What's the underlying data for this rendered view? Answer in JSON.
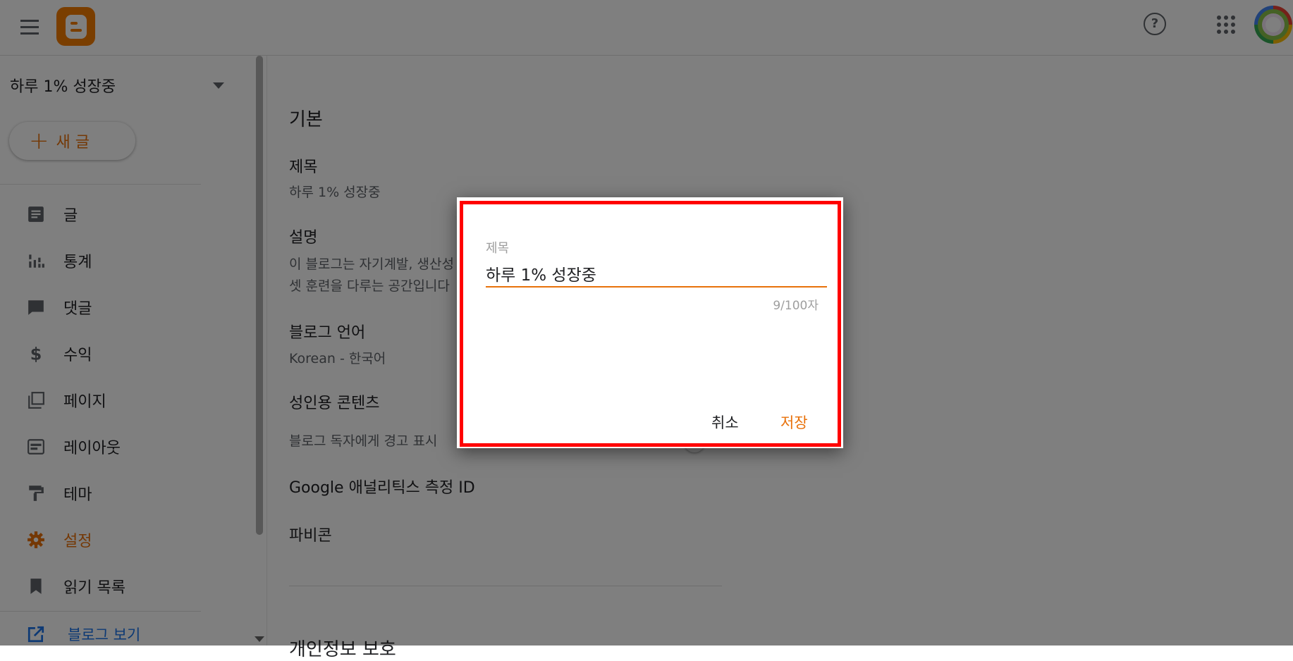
{
  "header": {
    "help_icon": "help-circle-icon",
    "apps_icon": "apps-grid-icon"
  },
  "sidebar": {
    "blog_title": "하루 1% 성장중",
    "new_post_label": "새 글",
    "items": [
      {
        "label": "글",
        "icon": "posts-icon"
      },
      {
        "label": "통계",
        "icon": "stats-icon"
      },
      {
        "label": "댓글",
        "icon": "comments-icon"
      },
      {
        "label": "수익",
        "icon": "dollar-icon"
      },
      {
        "label": "페이지",
        "icon": "pages-icon"
      },
      {
        "label": "레이아웃",
        "icon": "layout-icon"
      },
      {
        "label": "테마",
        "icon": "theme-icon"
      },
      {
        "label": "설정",
        "icon": "gear-icon",
        "active": true
      },
      {
        "label": "읽기 목록",
        "icon": "bookmark-icon"
      }
    ],
    "view_blog_label": "블로그 보기"
  },
  "main": {
    "section_title": "기본",
    "settings": [
      {
        "label": "제목",
        "value": "하루 1% 성장중"
      },
      {
        "label": "설명",
        "value_line1": "이 블로그는 자기계발, 생산성",
        "value_line2": "셋 훈련을 다루는 공간입니다"
      },
      {
        "label": "블로그 언어",
        "value": "Korean - 한국어"
      },
      {
        "label": "성인용 콘텐츠",
        "value": "블로그 독자에게 경고 표시"
      },
      {
        "label": "Google 애널리틱스 측정 ID"
      },
      {
        "label": "파비콘"
      }
    ],
    "next_section_partial": "개인정보 보호"
  },
  "dialog": {
    "field_label": "제목",
    "field_value": "하루 1% 성장중",
    "counter": "9/100자",
    "cancel_label": "취소",
    "save_label": "저장"
  },
  "colors": {
    "accent": "#e8710a",
    "highlight_frame": "#ff0000",
    "logo": "#f57d00"
  }
}
